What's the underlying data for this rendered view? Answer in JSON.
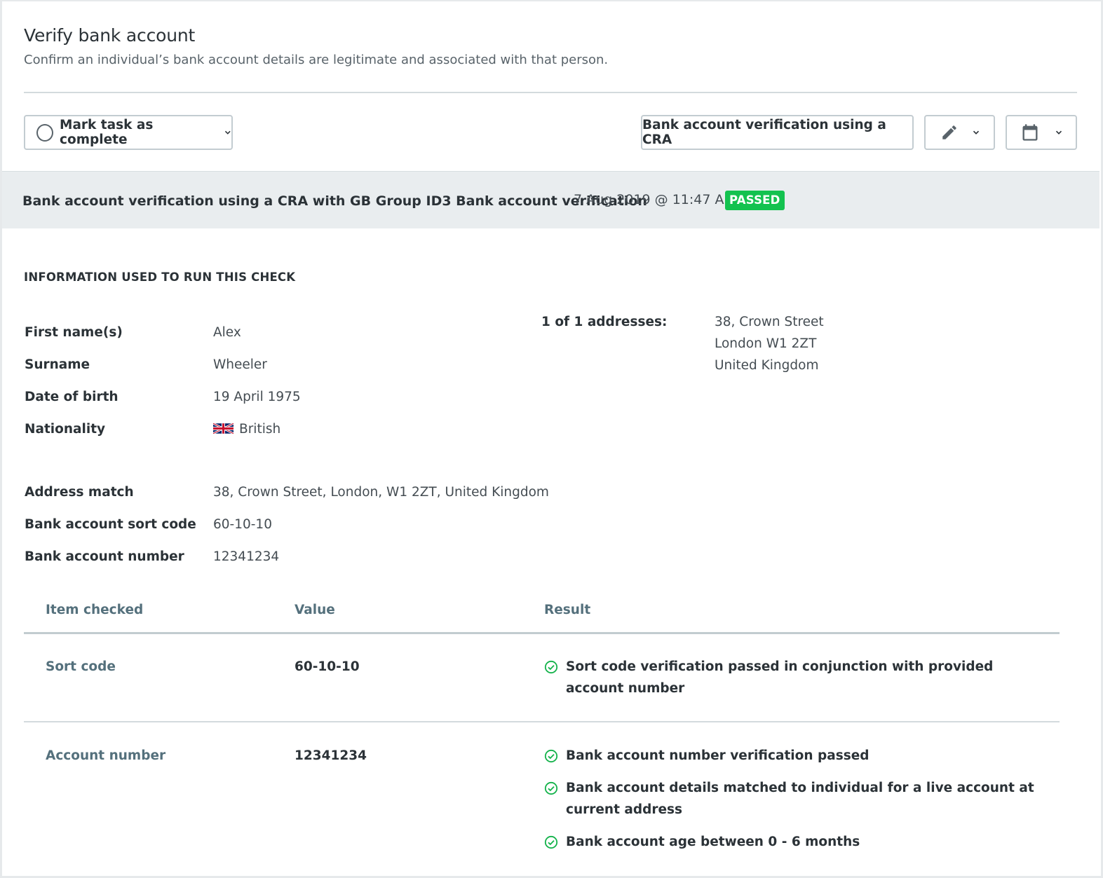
{
  "header": {
    "title": "Verify bank account",
    "subtitle": "Confirm an individual’s bank account details are legitimate and associated with that person."
  },
  "toolbar": {
    "complete_label": "Mark task as complete",
    "check_type_label": "Bank account verification using a CRA",
    "edit_icon": "pencil-icon",
    "calendar_icon": "calendar-icon"
  },
  "check": {
    "title": "Bank account verification using a CRA with GB Group ID3 Bank account verification",
    "timestamp": "7 Aug 2019 @ 11:47 AM",
    "status": "PASSED",
    "status_color": "#13c24f"
  },
  "info": {
    "heading": "INFORMATION USED TO RUN THIS CHECK",
    "fields": [
      {
        "label": "First name(s)",
        "value": "Alex"
      },
      {
        "label": "Surname",
        "value": "Wheeler"
      },
      {
        "label": "Date of birth",
        "value": "19 April 1975"
      },
      {
        "label": "Nationality",
        "value": "British",
        "icon": "uk-flag-icon"
      }
    ],
    "address_label": "1 of 1 addresses:",
    "address_lines": [
      "38, Crown Street",
      "London W1 2ZT",
      "United Kingdom"
    ],
    "bank_fields": [
      {
        "label": "Address match",
        "value": "38, Crown Street, London, W1 2ZT, United Kingdom"
      },
      {
        "label": "Bank account sort code",
        "value": "60-10-10"
      },
      {
        "label": "Bank account number",
        "value": "12341234"
      }
    ]
  },
  "results_table": {
    "headers": [
      "Item checked",
      "Value",
      "Result"
    ],
    "rows": [
      {
        "item": "Sort code",
        "value": "60-10-10",
        "results": [
          "Sort code verification passed in conjunction with provided account number"
        ]
      },
      {
        "item": "Account number",
        "value": "12341234",
        "results": [
          "Bank account number verification passed",
          "Bank account details matched to individual for a live account at current address",
          "Bank account age between 0 - 6 months"
        ]
      }
    ],
    "pass_icon": "check-circle-icon",
    "pass_color": "#13b24a"
  }
}
